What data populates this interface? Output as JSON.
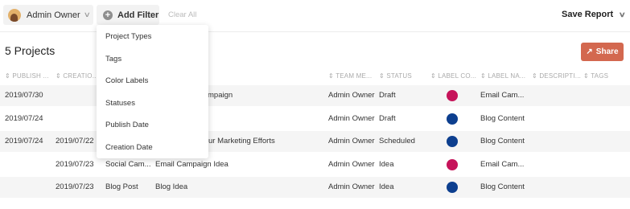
{
  "toolbar": {
    "owner_label": "Admin Owner",
    "add_filter_label": "Add Filter",
    "clear_all_label": "Clear All",
    "save_report_label": "Save Report"
  },
  "page": {
    "title": "5 Projects",
    "share_label": "Share"
  },
  "table": {
    "columns": [
      "PUBLISH ...",
      "CREATIO...",
      "TEAM ME...",
      "STATUS",
      "LABEL CO...",
      "LABEL NA...",
      "DESCRIPTI...",
      "TAGS"
    ],
    "rows": [
      {
        "publish": "2019/07/30",
        "created": "",
        "type": "",
        "title": "mpaign",
        "team": "Admin Owner",
        "status": "Draft",
        "label_color": "#c6145a",
        "label_name": "Email Cam..."
      },
      {
        "publish": "2019/07/24",
        "created": "",
        "type": "",
        "title": "",
        "team": "Admin Owner",
        "status": "Draft",
        "label_color": "#0d3f8f",
        "label_name": "Blog Content"
      },
      {
        "publish": "2019/07/24",
        "created": "2019/07/22",
        "type": "",
        "title": "ur Marketing Efforts",
        "team": "Admin Owner",
        "status": "Scheduled",
        "label_color": "#0d3f8f",
        "label_name": "Blog Content"
      },
      {
        "publish": "",
        "created": "2019/07/23",
        "type": "Social Cam...",
        "title": "Email Campaign Idea",
        "team": "Admin Owner",
        "status": "Idea",
        "label_color": "#c6145a",
        "label_name": "Email Cam..."
      },
      {
        "publish": "",
        "created": "2019/07/23",
        "type": "Blog Post",
        "title": "Blog Idea",
        "team": "Admin Owner",
        "status": "Idea",
        "label_color": "#0d3f8f",
        "label_name": "Blog Content"
      }
    ]
  },
  "filter_menu": {
    "items": [
      "Project Types",
      "Tags",
      "Color Labels",
      "Statuses",
      "Publish Date",
      "Creation Date"
    ]
  },
  "colors": {
    "share_button": "#d3684f",
    "email_label": "#c6145a",
    "blog_label": "#0d3f8f"
  }
}
